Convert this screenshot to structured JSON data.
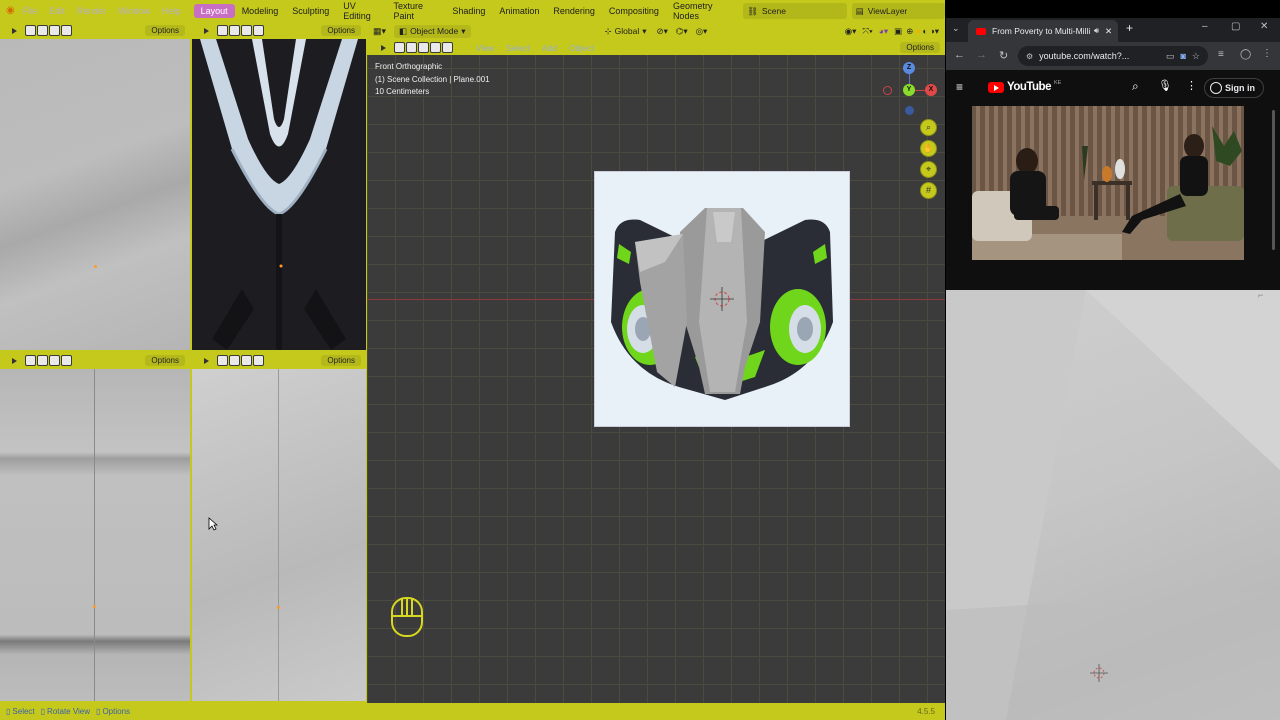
{
  "blender": {
    "menus": [
      "File",
      "Edit",
      "Render",
      "Window",
      "Help"
    ],
    "workspaces": [
      {
        "label": "Layout",
        "active": true
      },
      {
        "label": "Modeling",
        "active": false
      },
      {
        "label": "Sculpting",
        "active": false
      },
      {
        "label": "UV Editing",
        "active": false
      },
      {
        "label": "Texture Paint",
        "active": false
      },
      {
        "label": "Shading",
        "active": false
      },
      {
        "label": "Animation",
        "active": false
      },
      {
        "label": "Rendering",
        "active": false
      },
      {
        "label": "Compositing",
        "active": false
      },
      {
        "label": "Geometry Nodes",
        "active": false
      }
    ],
    "scene": "Scene",
    "view_layer": "ViewLayer",
    "options_label": "Options",
    "main_header": {
      "mode": "Object Mode",
      "menus": [
        "View",
        "Select",
        "Add",
        "Object"
      ],
      "orientation": "Global"
    },
    "viewport_info": {
      "view": "Front Orthographic",
      "collection": "(1) Scene Collection | Plane.001",
      "scale": "10 Centimeters"
    },
    "gizmo": {
      "z": "Z",
      "y": "Y",
      "x": "X"
    },
    "statusbar": {
      "items": [
        "Select",
        "Rotate View",
        "Options"
      ],
      "version": "4.5.5"
    }
  },
  "browser": {
    "tab_title": "From Poverty to Multi-Milli",
    "url": "youtube.com/watch?...",
    "youtube": {
      "brand": "YouTube",
      "region": "KE",
      "signin": "Sign in"
    }
  },
  "colors": {
    "theme_accent": "#c4c91c",
    "active_tab": "#c96fc3",
    "youtube_red": "#ff0000",
    "mask_green": "#6fd61c"
  }
}
